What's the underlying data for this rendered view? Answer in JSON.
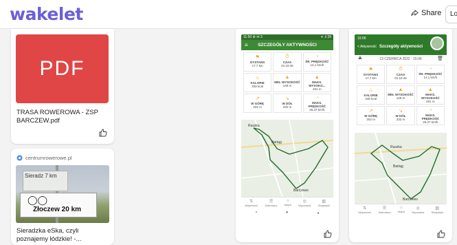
{
  "header": {
    "logo": "wakelet",
    "share_label": "Share",
    "login_label": "Lo"
  },
  "cards": {
    "pdf": {
      "thumb_label": "PDF",
      "title": "TRASA ROWEROWA - ZSP BARCZEW.pdf"
    },
    "article": {
      "source": "centrumrowerowe.pl",
      "title": "Sieradzka eSka, czyli poznajemy łódzkie! -...",
      "photo_sign_top": "Sieradz 7 km",
      "photo_sign_bottom": "Złoczew 20 km"
    },
    "screenshot1": {
      "status_left": "11:50 ⚙ ✉ 3",
      "status_right": "▾ .ıl 39",
      "header_title": "SZCZEGÓŁY AKTYWNOŚCI",
      "stats": [
        {
          "label": "DYSTANS",
          "value": "17.7 km"
        },
        {
          "label": "CZAS",
          "value": "01:15:45"
        },
        {
          "label": "ŚR. PRĘDKOŚĆ",
          "value": "14,1 km/h"
        },
        {
          "label": "KALORIE",
          "value": "348 kcal"
        },
        {
          "label": "MIN. WYSOKOŚĆ",
          "value": "148 m"
        },
        {
          "label": "MAKS. WYSOKO...",
          "value": "201 m"
        },
        {
          "label": "W GÓRĘ",
          "value": "202 m"
        },
        {
          "label": "W DÓŁ",
          "value": "232 m"
        },
        {
          "label": "MAKS. PRĘDKOŚĆ",
          "value": "26,37 km/h"
        }
      ],
      "nav": [
        "Aktywność",
        "Kalendarz",
        "Mapa",
        "Wyzwania",
        "Statystyki"
      ],
      "sys": [
        "▪",
        "●",
        "◂"
      ],
      "map_labels": [
        "Ruszka",
        "Bartąg",
        "Barczewo"
      ]
    },
    "screenshot2": {
      "status_left": "15:06",
      "back_label": "< Aktywność",
      "header_title": "Szczegóły aktywności",
      "date": "13 CZERWCA 2022 - 15:06",
      "stats": [
        {
          "label": "DYSTANS",
          "value": "17.7 km"
        },
        {
          "label": "CZAS",
          "value": "01:15:45"
        },
        {
          "label": "ŚR. PRĘDKOŚĆ",
          "value": "14,1 km/h"
        },
        {
          "label": "KALORIE",
          "value": "348 kcal"
        },
        {
          "label": "MIN. WYSOKOŚĆ",
          "value": "148 m"
        },
        {
          "label": "MAKS. WYSOKOŚĆ",
          "value": "201 m"
        },
        {
          "label": "W GÓRĘ",
          "value": "202 m"
        },
        {
          "label": "W DÓŁ",
          "value": "232 m"
        },
        {
          "label": "MAKS. PRĘDKOŚĆ",
          "value": "26,37 km/h"
        }
      ],
      "nav": [
        "Aktywność",
        "Kalendarz",
        "Mapa",
        "Wyzwania",
        "Statystyki"
      ],
      "map_labels": [
        "Ruszka",
        "Bartąg",
        "Barczewo"
      ]
    }
  },
  "colors": {
    "brand": "#6b5fd8",
    "pdf_red": "#e04646",
    "app_green": "#3d8a34"
  }
}
